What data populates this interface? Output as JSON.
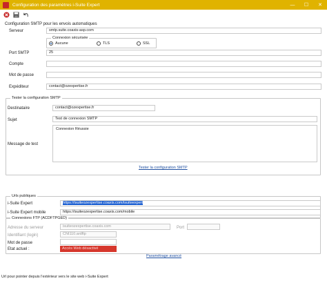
{
  "window": {
    "title": "Configuration des paramètres i-Suite Expert",
    "minimize": "—",
    "maximize": "☐",
    "close": "✕"
  },
  "smtp": {
    "section_label": "Configuration SMTP pour les envois automatiques",
    "server_label": "Serveur",
    "server_value": "smtp.suite.coaxis-asp.com",
    "security_title": "Connexion sécurisée",
    "opt_none": "Aucune",
    "opt_tls": "TLS",
    "opt_ssl": "SSL",
    "port_label": "Port SMTP",
    "port_value": "25",
    "account_label": "Compte",
    "account_value": "",
    "password_label": "Mot de passe",
    "password_value": "",
    "sender_label": "Expéditeur",
    "sender_value": "contact@ozexpertise.fr"
  },
  "test": {
    "title": "Tester la configuration SMTP",
    "recipient_label": "Destinataire",
    "recipient_value": "contact@ozexpertise.fr",
    "subject_label": "Sujet",
    "subject_value": "Test de connexion SMTP",
    "message_label": "Message de test",
    "message_value": "Connexion Réussie",
    "test_link": "Tester la configuration SMTP"
  },
  "urls": {
    "title": "Urls publiques",
    "isuite_label": "i-Suite Expert",
    "isuite_value": "https://isuiteozexpertise.coaxis.com/isuiteexpert",
    "mobile_label": "i-Suite Expert mobile",
    "mobile_value": "https://isuiteozexpertise.coaxis.com/mobile"
  },
  "ftp": {
    "title": "Connexions FTP (ACDFTPGED)",
    "address_label": "Adresse du serveur",
    "address_value": "isuiteozexpertise.coaxis.com",
    "port_label": "Port",
    "port_value": "",
    "login_label": "Identifiant (login)",
    "login_value": "CNI110.ardftp",
    "password_label": "Mot de passe",
    "password_value": "",
    "state_label": "Etat actuel :",
    "state_value": "Accès Web désactivé"
  },
  "advanced_link": "Paramétrage avancé",
  "status_text": "Url pour pointer depuis l'extérieur vers le site web i-Suite Expert",
  "colors": {
    "titlebar": "#e0b300",
    "state_error": "#d6372c",
    "link": "#1f4fa0",
    "selection": "#1c5fd1"
  }
}
